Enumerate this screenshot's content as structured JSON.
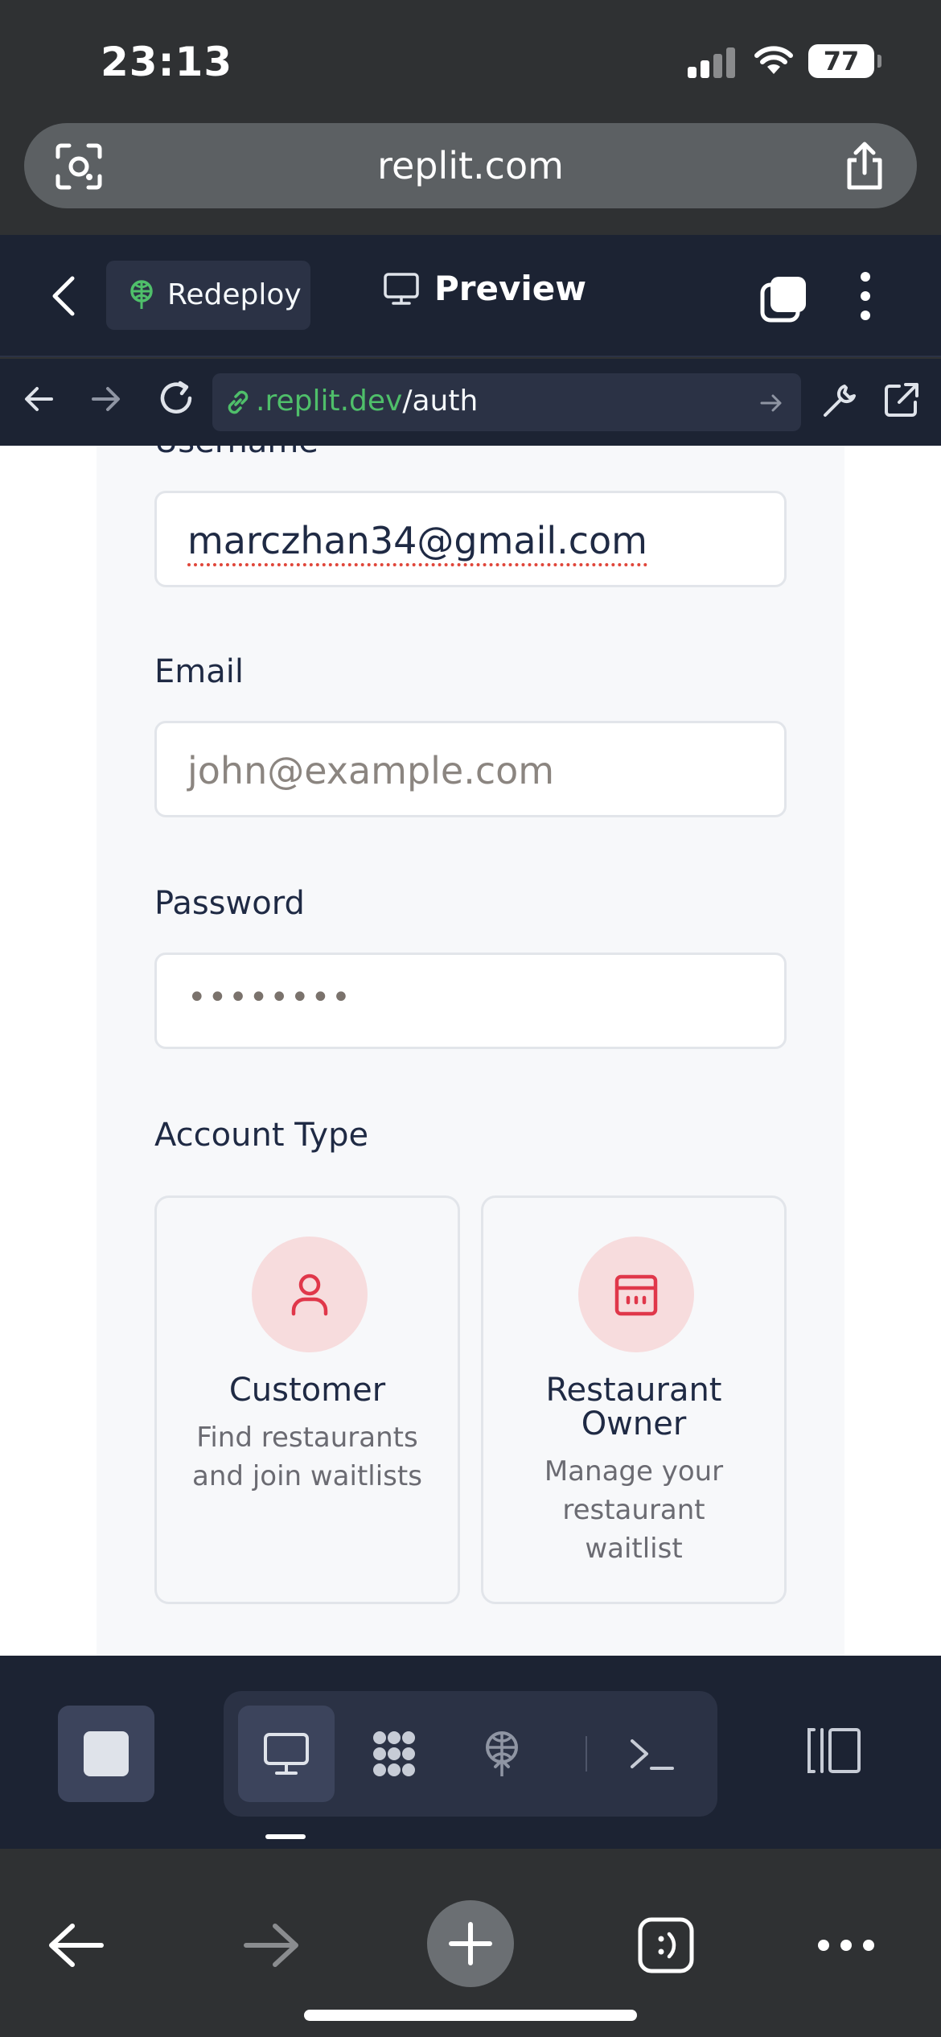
{
  "status_bar": {
    "time": "23:13",
    "battery": "77"
  },
  "safari": {
    "domain": "replit.com"
  },
  "replit_header": {
    "redeploy_label": "Redeploy",
    "preview_label": "Preview"
  },
  "preview_nav": {
    "url_host": ".replit.dev",
    "url_path": "/auth"
  },
  "form": {
    "username_label": "Username",
    "username_value": "marczhan34@gmail.com",
    "email_label": "Email",
    "email_placeholder": "john@example.com",
    "password_label": "Password",
    "password_value": "••••••••",
    "account_type_label": "Account Type",
    "options": [
      {
        "title": "Customer",
        "desc_lines": [
          "Find restaurants",
          "and join waitlists"
        ],
        "icon": "user-icon"
      },
      {
        "title_lines": [
          "Restaurant",
          "Owner"
        ],
        "desc_lines": [
          "Manage your",
          "restaurant",
          "waitlist"
        ],
        "icon": "calendar-store-icon"
      }
    ]
  },
  "colors": {
    "accent": "#e0374a",
    "accent_bg": "#f7dcdd",
    "replit_bg": "#1c2333",
    "link_green": "#4fbf6a"
  }
}
